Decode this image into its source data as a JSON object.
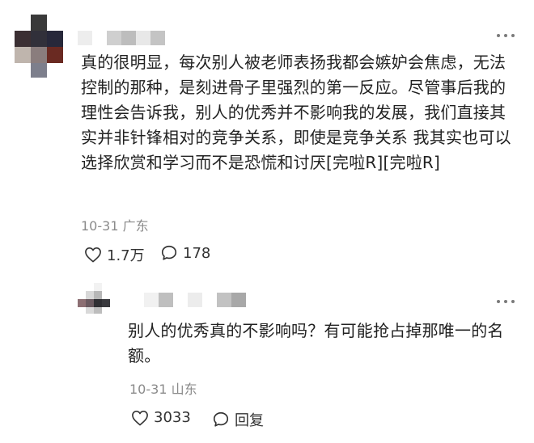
{
  "colors": {
    "text": "#222222",
    "meta": "#8a8a8a",
    "icon": "#333333"
  },
  "comments": [
    {
      "text": "真的很明显，每次别人被老师表扬我都会嫉妒会焦虑，无法控制的那种，是刻进骨子里强烈的第一反应。尽管事后我的理性会告诉我，别人的优秀并不影响我的发展，我们直接其实并非针锋相对的竞争关系，即使是竞争关系 我其实也可以选择欣赏和学习而不是恐慌和讨厌[完啦R][完啦R]",
      "date": "10-31",
      "location": "广东",
      "likes": "1.7万",
      "comments_count": "178",
      "like_icon": "heart-outline-icon",
      "comment_icon": "speech-bubble-icon",
      "more_icon": "more-dots-icon"
    }
  ],
  "reply": {
    "text": "别人的优秀真的不影响吗？有可能抢占掉那唯一的名额。",
    "date": "10-31",
    "location": "山东",
    "likes": "3033",
    "reply_label": "回复",
    "like_icon": "heart-outline-icon",
    "reply_icon": "speech-bubble-icon",
    "more_icon": "more-dots-icon"
  }
}
